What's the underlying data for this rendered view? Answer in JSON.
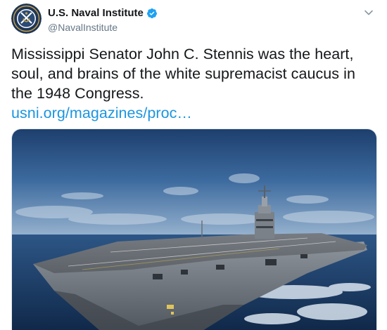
{
  "account": {
    "display_name": "U.S. Naval Institute",
    "handle": "@NavalInstitute",
    "verified": true,
    "avatar_icon": "naval-institute-seal-icon"
  },
  "tweet": {
    "text_lines": [
      "Mississippi Senator John C. Stennis was the heart,",
      "soul, and brains of the white supremacist caucus in",
      "the 1948 Congress."
    ],
    "link_text": "usni.org/magazines/proc…"
  },
  "media": {
    "type": "photo",
    "subject": "aircraft-carrier-at-sea"
  },
  "colors": {
    "link": "#1b95e0",
    "verified": "#1da1f2",
    "text": "#14171a",
    "secondary": "#657786"
  },
  "icons": {
    "verified": "verified-badge-icon",
    "menu": "chevron-down-icon"
  }
}
